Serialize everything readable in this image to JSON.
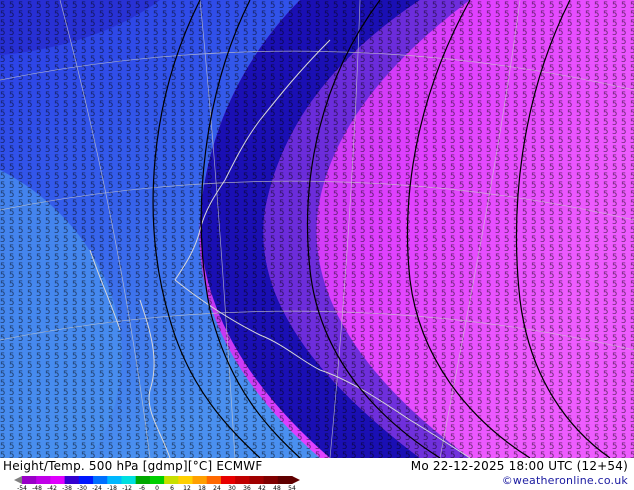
{
  "footer": {
    "title": "Height/Temp. 500 hPa [gdmp][°C] ECMWF",
    "datetime": "Mo 22-12-2025 18:00 UTC (12+54)",
    "credit": "©weatheronline.co.uk"
  },
  "legend": {
    "ticks": [
      "-54",
      "-48",
      "-42",
      "-38",
      "-30",
      "-24",
      "-18",
      "-12",
      "-6",
      "0",
      "6",
      "12",
      "18",
      "24",
      "30",
      "36",
      "42",
      "48",
      "54"
    ],
    "colors": [
      "#9a00c8",
      "#c000e8",
      "#e000ff",
      "#3400d0",
      "#0018ff",
      "#0070ff",
      "#00b8ff",
      "#00e0e0",
      "#00a800",
      "#00d000",
      "#c8e000",
      "#ffd000",
      "#ffa000",
      "#ff6800",
      "#e80000",
      "#c00000",
      "#a00000",
      "#800000",
      "#600000"
    ]
  },
  "map": {
    "colors": {
      "deep_blue": "#1a0fb4",
      "blue": "#2a3ae6",
      "mid_blue": "#3870ee",
      "light_blue": "#4a90f0",
      "purple": "#8a3ae0",
      "violet": "#b030e8",
      "magenta": "#e040ff",
      "pink": "#ee5cff"
    }
  }
}
